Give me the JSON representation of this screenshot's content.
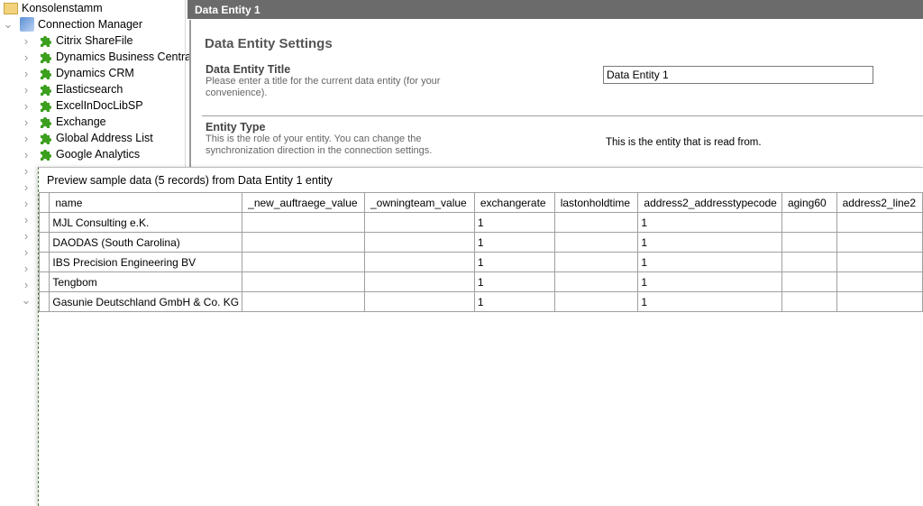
{
  "tree": {
    "root": "Konsolenstamm",
    "manager": "Connection Manager",
    "children": [
      "Citrix ShareFile",
      "Dynamics Business Central",
      "Dynamics CRM",
      "Elasticsearch",
      "ExcelInDocLibSP",
      "Exchange",
      "Global Address List",
      "Google Analytics"
    ],
    "icon": "puzzle-icon",
    "icon_color": "#3ca01e"
  },
  "header": {
    "title": "Data Entity 1"
  },
  "settings": {
    "heading": "Data Entity Settings",
    "title_label": "Data Entity Title",
    "title_desc": "Please enter a title for the current data entity (for your convenience).",
    "title_value": "Data Entity 1",
    "type_label": "Entity Type",
    "type_desc": "This is the role of your entity. You can change the synchronization direction in the connection settings.",
    "type_value": "This is the entity that is read from."
  },
  "preview": {
    "title": "Preview sample data (5 records) from Data Entity 1 entity",
    "columns": [
      "name",
      "_new_auftraege_value",
      "_owningteam_value",
      "exchangerate",
      "lastonholdtime",
      "address2_addresstypecode",
      "aging60",
      "address2_line2"
    ],
    "rows": [
      [
        "MJL Consulting e.K.",
        "",
        "",
        "1",
        "",
        "1",
        "",
        ""
      ],
      [
        "DAODAS (South Carolina)",
        "",
        "",
        "1",
        "",
        "1",
        "",
        ""
      ],
      [
        "IBS Precision Engineering BV",
        "",
        "",
        "1",
        "",
        "1",
        "",
        ""
      ],
      [
        "Tengbom",
        "",
        "",
        "1",
        "",
        "1",
        "",
        ""
      ],
      [
        "Gasunie Deutschland GmbH & Co. KG",
        "",
        "",
        "1",
        "",
        "1",
        "",
        ""
      ]
    ]
  }
}
